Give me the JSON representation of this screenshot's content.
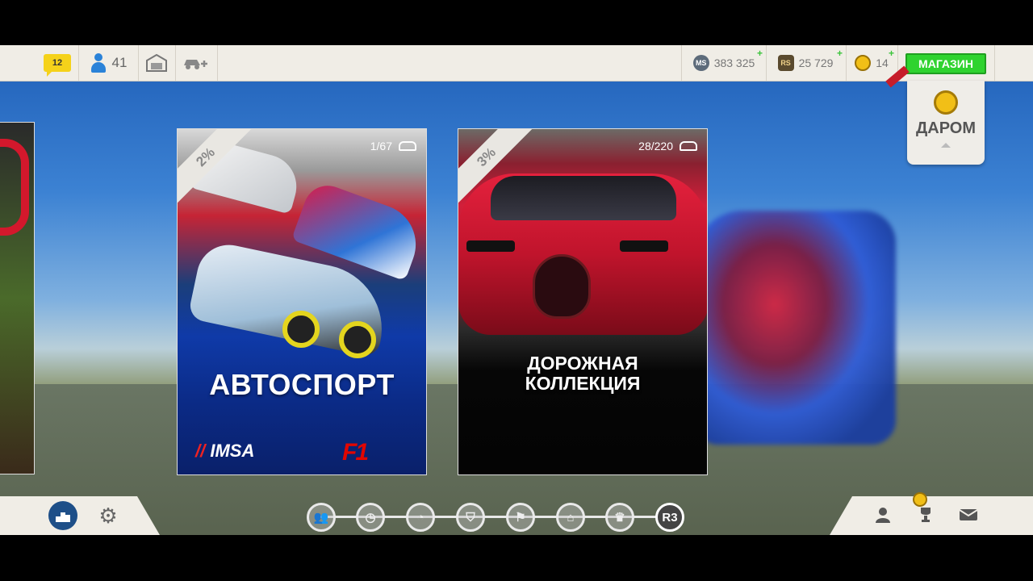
{
  "topbar": {
    "messages_count": "12",
    "friends_count": "41",
    "currencies": [
      {
        "icon": "MS",
        "value": "383 325"
      },
      {
        "icon": "RS",
        "value": "25 729"
      },
      {
        "icon": "gold-coin",
        "value": "14"
      }
    ],
    "shop_label": "МАГАЗИН"
  },
  "free_panel": {
    "label": "ДАРОМ"
  },
  "cards": [
    {
      "title": "АВТОСПОРТ",
      "percent": "2%",
      "progress": "1/67",
      "logos": [
        "IMSA",
        "F1"
      ]
    },
    {
      "title": "ДОРОЖНАЯ\nКОЛЛЕКЦИЯ",
      "percent": "3%",
      "progress": "28/220"
    }
  ],
  "nav": {
    "icons": [
      "group-icon",
      "stopwatch-icon",
      "clock-icon",
      "shield-icon",
      "flags-icon",
      "garage-icon",
      "trophy-wreath-icon",
      "r3-icon"
    ],
    "active_label": "R3"
  },
  "colors": {
    "accent_green": "#2fd32f",
    "brand_red": "#c61d2a",
    "sky_blue": "#3c82d3"
  }
}
